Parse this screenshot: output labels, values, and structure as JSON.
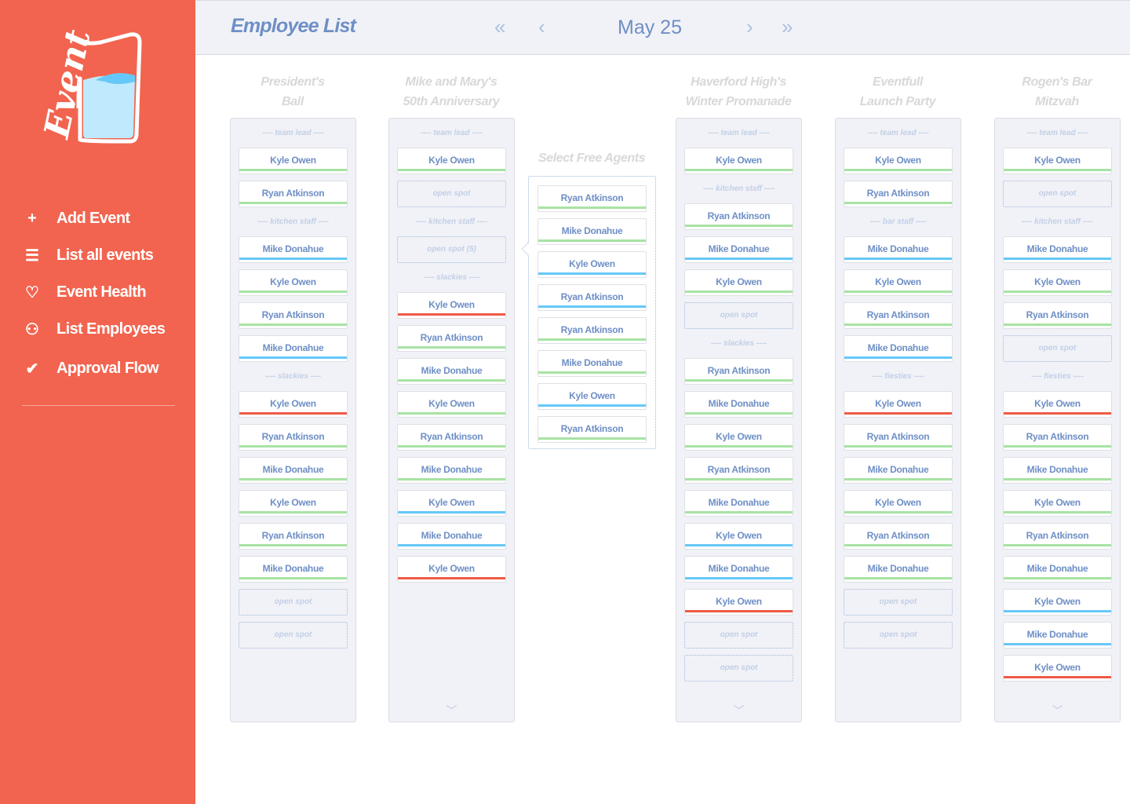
{
  "colors": {
    "sidebar": "#f2644f",
    "accent_text": "#6e8fc6",
    "green": "#a8e2a4",
    "blue": "#66c8f8",
    "red": "#ee5a45"
  },
  "sidebar": {
    "logo_text": "Event",
    "items": [
      {
        "icon": "plus-icon",
        "glyph": "+",
        "label": "Add Event"
      },
      {
        "icon": "list-icon",
        "glyph": "☰",
        "label": "List all events"
      },
      {
        "icon": "heart-icon",
        "glyph": "♡",
        "label": "Event Health"
      },
      {
        "icon": "users-icon",
        "glyph": "⚇",
        "label": "List Employees"
      },
      {
        "icon": "check-icon",
        "glyph": "✔",
        "label": "Approval Flow"
      }
    ]
  },
  "header": {
    "title": "Employee List",
    "date": "May 25",
    "first": "«",
    "prev": "‹",
    "next": "›",
    "last": "»"
  },
  "free_agents": {
    "title": "Select Free Agents",
    "items": [
      {
        "name": "Ryan Atkinson",
        "status": "green"
      },
      {
        "name": "Mike Donahue",
        "status": "green"
      },
      {
        "name": "Kyle Owen",
        "status": "blue"
      },
      {
        "name": "Ryan Atkinson",
        "status": "blue"
      },
      {
        "name": "Ryan Atkinson",
        "status": "green"
      },
      {
        "name": "Mike Donahue",
        "status": "green"
      },
      {
        "name": "Kyle Owen",
        "status": "blue"
      },
      {
        "name": "Ryan Atkinson",
        "status": "green"
      }
    ]
  },
  "events": [
    {
      "title": [
        "President's",
        "Ball"
      ],
      "scroll": false,
      "items": [
        {
          "t": "label",
          "v": "---- team lead ----"
        },
        {
          "t": "card",
          "v": "Kyle Owen",
          "s": "green"
        },
        {
          "t": "card",
          "v": "Ryan Atkinson",
          "s": "green"
        },
        {
          "t": "label",
          "v": "---- kitchen staff ----"
        },
        {
          "t": "card",
          "v": "Mike Donahue",
          "s": "blue"
        },
        {
          "t": "card",
          "v": "Kyle Owen",
          "s": "green"
        },
        {
          "t": "card",
          "v": "Ryan Atkinson",
          "s": "green"
        },
        {
          "t": "card",
          "v": "Mike Donahue",
          "s": "blue"
        },
        {
          "t": "label",
          "v": "---- slackies ----"
        },
        {
          "t": "card",
          "v": "Kyle Owen",
          "s": "red"
        },
        {
          "t": "card",
          "v": "Ryan Atkinson",
          "s": "green"
        },
        {
          "t": "card",
          "v": "Mike Donahue",
          "s": "green"
        },
        {
          "t": "card",
          "v": "Kyle Owen",
          "s": "green"
        },
        {
          "t": "card",
          "v": "Ryan Atkinson",
          "s": "green"
        },
        {
          "t": "card",
          "v": "Mike Donahue",
          "s": "green"
        },
        {
          "t": "open",
          "v": "open spot"
        },
        {
          "t": "open",
          "v": "open spot"
        }
      ]
    },
    {
      "title": [
        "Mike and Mary's",
        "50th Anniversary"
      ],
      "scroll": true,
      "items": [
        {
          "t": "label",
          "v": "---- team lead ----"
        },
        {
          "t": "card",
          "v": "Kyle Owen",
          "s": "green"
        },
        {
          "t": "open",
          "v": "open spot"
        },
        {
          "t": "label",
          "v": "---- kitchen staff ----"
        },
        {
          "t": "open",
          "v": "open spot (5)"
        },
        {
          "t": "label",
          "v": "---- slackies ----"
        },
        {
          "t": "card",
          "v": "Kyle Owen",
          "s": "red"
        },
        {
          "t": "card",
          "v": "Ryan Atkinson",
          "s": "green"
        },
        {
          "t": "card",
          "v": "Mike Donahue",
          "s": "green"
        },
        {
          "t": "card",
          "v": "Kyle Owen",
          "s": "green"
        },
        {
          "t": "card",
          "v": "Ryan Atkinson",
          "s": "green"
        },
        {
          "t": "card",
          "v": "Mike Donahue",
          "s": "green"
        },
        {
          "t": "card",
          "v": "Kyle Owen",
          "s": "blue"
        },
        {
          "t": "card",
          "v": "Mike Donahue",
          "s": "blue"
        },
        {
          "t": "card",
          "v": "Kyle Owen",
          "s": "red"
        }
      ]
    },
    {
      "title": [
        "Haverford High's",
        "Winter Promanade"
      ],
      "scroll": true,
      "items": [
        {
          "t": "label",
          "v": "---- team lead ----"
        },
        {
          "t": "card",
          "v": "Kyle Owen",
          "s": "green"
        },
        {
          "t": "label",
          "v": "---- kitchen staff ----"
        },
        {
          "t": "card",
          "v": "Ryan Atkinson",
          "s": "green"
        },
        {
          "t": "card",
          "v": "Mike Donahue",
          "s": "blue"
        },
        {
          "t": "card",
          "v": "Kyle Owen",
          "s": "green"
        },
        {
          "t": "open",
          "v": "open spot"
        },
        {
          "t": "label",
          "v": "---- slackies ----"
        },
        {
          "t": "card",
          "v": "Ryan Atkinson",
          "s": "green"
        },
        {
          "t": "card",
          "v": "Mike Donahue",
          "s": "green"
        },
        {
          "t": "card",
          "v": "Kyle Owen",
          "s": "green"
        },
        {
          "t": "card",
          "v": "Ryan Atkinson",
          "s": "green"
        },
        {
          "t": "card",
          "v": "Mike Donahue",
          "s": "green"
        },
        {
          "t": "card",
          "v": "Kyle Owen",
          "s": "blue"
        },
        {
          "t": "card",
          "v": "Mike Donahue",
          "s": "blue"
        },
        {
          "t": "card",
          "v": "Kyle Owen",
          "s": "red"
        },
        {
          "t": "open",
          "v": "open spot"
        },
        {
          "t": "open",
          "v": "open spot"
        }
      ]
    },
    {
      "title": [
        "Eventfull",
        "Launch Party"
      ],
      "scroll": false,
      "items": [
        {
          "t": "label",
          "v": "---- team lead ----"
        },
        {
          "t": "card",
          "v": "Kyle Owen",
          "s": "green"
        },
        {
          "t": "card",
          "v": "Ryan Atkinson",
          "s": "green"
        },
        {
          "t": "label",
          "v": "---- bar staff ----"
        },
        {
          "t": "card",
          "v": "Mike Donahue",
          "s": "blue"
        },
        {
          "t": "card",
          "v": "Kyle Owen",
          "s": "green"
        },
        {
          "t": "card",
          "v": "Ryan Atkinson",
          "s": "green"
        },
        {
          "t": "card",
          "v": "Mike Donahue",
          "s": "blue"
        },
        {
          "t": "label",
          "v": "---- fiesties ----"
        },
        {
          "t": "card",
          "v": "Kyle Owen",
          "s": "red"
        },
        {
          "t": "card",
          "v": "Ryan Atkinson",
          "s": "green"
        },
        {
          "t": "card",
          "v": "Mike Donahue",
          "s": "green"
        },
        {
          "t": "card",
          "v": "Kyle Owen",
          "s": "green"
        },
        {
          "t": "card",
          "v": "Ryan Atkinson",
          "s": "green"
        },
        {
          "t": "card",
          "v": "Mike Donahue",
          "s": "green"
        },
        {
          "t": "open",
          "v": "open spot"
        },
        {
          "t": "open",
          "v": "open spot"
        }
      ]
    },
    {
      "title": [
        "Rogen's Bar",
        "Mitzvah"
      ],
      "scroll": true,
      "items": [
        {
          "t": "label",
          "v": "---- team lead ----"
        },
        {
          "t": "card",
          "v": "Kyle Owen",
          "s": "green"
        },
        {
          "t": "open",
          "v": "open spot"
        },
        {
          "t": "label",
          "v": "---- kitchen staff ----"
        },
        {
          "t": "card",
          "v": "Mike Donahue",
          "s": "blue"
        },
        {
          "t": "card",
          "v": "Kyle Owen",
          "s": "green"
        },
        {
          "t": "card",
          "v": "Ryan Atkinson",
          "s": "green"
        },
        {
          "t": "open",
          "v": "open spot"
        },
        {
          "t": "label",
          "v": "---- fiesties ----"
        },
        {
          "t": "card",
          "v": "Kyle Owen",
          "s": "red"
        },
        {
          "t": "card",
          "v": "Ryan Atkinson",
          "s": "green"
        },
        {
          "t": "card",
          "v": "Mike Donahue",
          "s": "green"
        },
        {
          "t": "card",
          "v": "Kyle Owen",
          "s": "green"
        },
        {
          "t": "card",
          "v": "Ryan Atkinson",
          "s": "green"
        },
        {
          "t": "card",
          "v": "Mike Donahue",
          "s": "green"
        },
        {
          "t": "card",
          "v": "Kyle Owen",
          "s": "blue"
        },
        {
          "t": "card",
          "v": "Mike Donahue",
          "s": "blue"
        },
        {
          "t": "card",
          "v": "Kyle Owen",
          "s": "red"
        }
      ]
    }
  ]
}
